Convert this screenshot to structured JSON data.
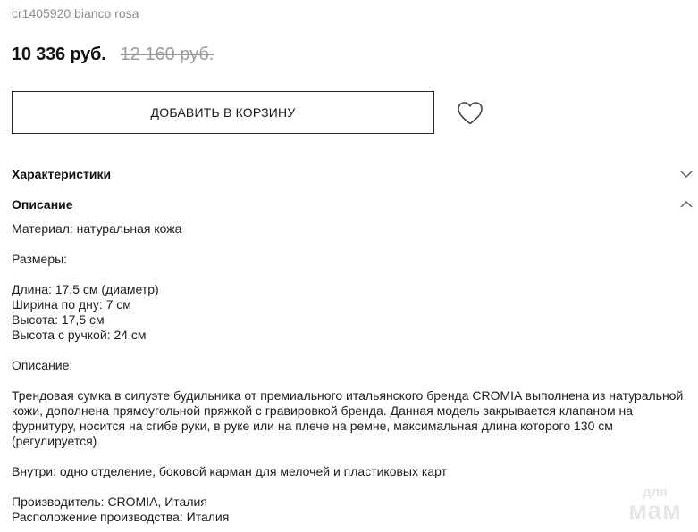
{
  "product": {
    "sku": "cr1405920 bianco rosa",
    "price": "10 336 руб.",
    "old_price": "12 160 руб."
  },
  "actions": {
    "add_to_cart": "ДОБАВИТЬ В КОРЗИНУ",
    "favorite_icon": "heart-icon"
  },
  "accordion": {
    "characteristics": {
      "title": "Характеристики",
      "state": "collapsed"
    },
    "description": {
      "title": "Описание",
      "state": "expanded"
    }
  },
  "description": {
    "material": "Материал: натуральная кожа",
    "sizes_label": "Размеры:",
    "length": "Длина: 17,5 см (диаметр)",
    "width": "Ширина по дну: 7 см",
    "height": "Высота: 17,5 см",
    "height_handle": "Высота с ручкой: 24 см",
    "desc_label": "Описание:",
    "text": "Трендовая сумка в силуэте будильника от премиального итальянского бренда CROMIA выполнена из натуральной кожи, дополнена прямоугольной пряжкой с гравировкой бренда. Данная модель закрывается клапаном на фурнитуру, носится на сгибе руки, в руке или на плече на ремне, максимальная длина которого 130 см (регулируется)",
    "inside": "Внутри: одно отделение, боковой карман для мелочей и пластиковых карт",
    "manufacturer": "Производитель: CROMIA, Италия",
    "production_location": "Расположение производства: Италия"
  },
  "watermark": {
    "line1": "для",
    "line2": "мам"
  }
}
